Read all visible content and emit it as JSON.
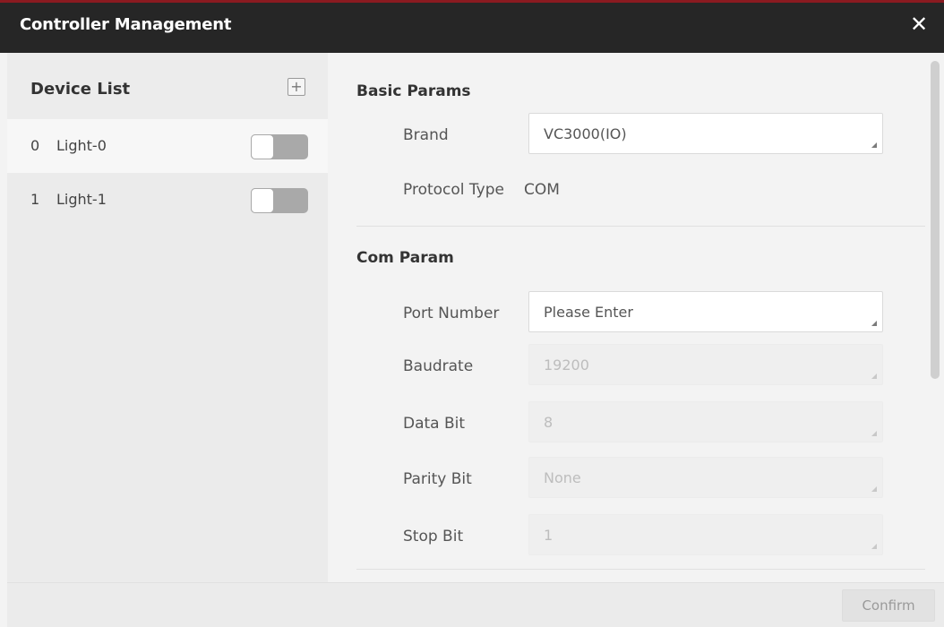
{
  "dialog": {
    "title": "Controller Management",
    "close_icon": "✕"
  },
  "sidebar": {
    "title": "Device List",
    "add_icon": "+",
    "devices": [
      {
        "index": "0",
        "name": "Light-0",
        "enabled": false,
        "selected": true
      },
      {
        "index": "1",
        "name": "Light-1",
        "enabled": false,
        "selected": false
      }
    ]
  },
  "basic": {
    "title": "Basic Params",
    "brand_label": "Brand",
    "brand_value": "VC3000(IO)",
    "protocol_label": "Protocol Type",
    "protocol_value": "COM"
  },
  "com": {
    "title": "Com Param",
    "port_label": "Port Number",
    "port_placeholder": "Please Enter",
    "baudrate_label": "Baudrate",
    "baudrate_value": "19200",
    "databit_label": "Data Bit",
    "databit_value": "8",
    "parity_label": "Parity Bit",
    "parity_value": "None",
    "stopbit_label": "Stop Bit",
    "stopbit_value": "1"
  },
  "footer": {
    "confirm_label": "Confirm"
  },
  "colors": {
    "titlebar": "#262626",
    "accent_line": "#8a1a20",
    "toggle_off": "#a9a9a9"
  }
}
